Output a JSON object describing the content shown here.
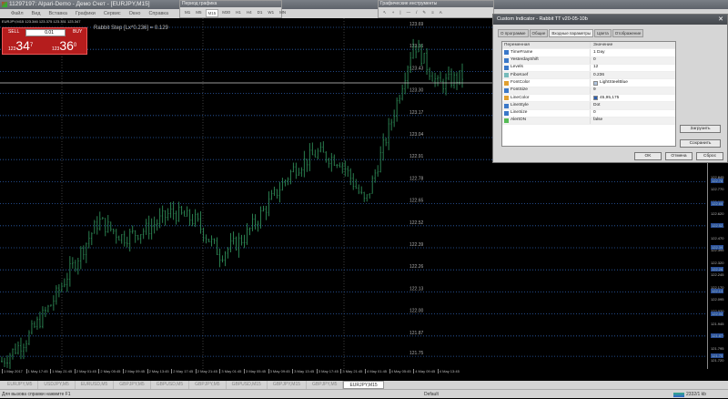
{
  "window": {
    "title": "11297197: Alpari-Demo - Демо Счет - [EURJPY,M15]"
  },
  "menu": [
    "Файл",
    "Вид",
    "Вставка",
    "Графики",
    "Сервис",
    "Окно",
    "Справка"
  ],
  "period_toolbar": {
    "title": "Период графика",
    "items": [
      "M1",
      "M5",
      "M15",
      "M30",
      "H1",
      "H4",
      "D1",
      "W1",
      "MN"
    ],
    "selected": "M15"
  },
  "tools_toolbar": {
    "title": "Графические инструменты",
    "items": [
      "↖",
      "+",
      "|",
      "—",
      "/",
      "✎",
      "≡",
      "A"
    ]
  },
  "chart": {
    "header": "EURJPY,M15  123.346 123.375 123.331 123.347",
    "sell_label": "SELL",
    "buy_label": "BUY",
    "lot": "0.01",
    "sell_price": {
      "big": "123",
      "main": "34",
      "pip": "7"
    },
    "buy_price": {
      "big": "123",
      "main": "36",
      "pip": "0"
    },
    "rabbit_text": "Rabbit Step [Lx*0.236] = 0.129",
    "levels": [
      "123.69",
      "123.56",
      "123.43",
      "123.30",
      "123.17",
      "123.04",
      "122.91",
      "122.78",
      "122.65",
      "122.52",
      "122.39",
      "122.26",
      "122.13",
      "122.00",
      "121.87",
      "121.75"
    ],
    "axis_labels": [
      "122.845",
      "122.770",
      "122.695",
      "122.620",
      "122.545",
      "122.470",
      "122.395",
      "122.320",
      "122.245",
      "122.170",
      "122.095",
      "122.020",
      "121.945",
      "121.870",
      "121.795",
      "121.720"
    ],
    "axis_highlight": [
      "122.78",
      "122.65",
      "122.52",
      "122.39",
      "122.26",
      "122.13",
      "122.00",
      "121.87",
      "121.75"
    ],
    "time_labels": [
      "1 May 2017",
      "1 May 17:45",
      "1 May 21:45",
      "2 May 01:45",
      "2 May 05:45",
      "2 May 09:45",
      "2 May 13:45",
      "2 May 17:45",
      "2 May 21:45",
      "3 May 01:45",
      "3 May 05:45",
      "3 May 09:45",
      "3 May 13:45",
      "3 May 17:45",
      "3 May 21:45",
      "4 May 01:45",
      "4 May 05:45",
      "4 May 09:45",
      "4 May 13:45"
    ],
    "candle_color": "#2e8b57"
  },
  "chart_data": {
    "type": "candlestick",
    "symbol": "EURJPY",
    "timeframe": "M15",
    "close_waypoints": [
      121.72,
      121.85,
      122.05,
      122.3,
      122.55,
      122.45,
      122.5,
      122.6,
      122.55,
      122.35,
      122.45,
      122.65,
      122.85,
      122.95,
      122.9,
      122.65,
      123.1,
      123.6,
      123.35,
      123.4
    ]
  },
  "tabs": [
    "EURJPY,M5",
    "USDJPY,M5",
    "EURUSD,M5",
    "GBPJPY,M5",
    "GBPUSD,M5",
    "GBPJPY,M5",
    "GBPUSD,M15",
    "GBPJPY,M15",
    "GBPJPY,M5",
    "EURJPY,M15"
  ],
  "active_tab": "EURJPY,M15",
  "status": {
    "help": "Для вызова справки нажмите F1",
    "profile": "Default",
    "traffic": "2332/1 kb"
  },
  "dialog": {
    "title": "Custom Indicator - Rabbit TT v20-05-10b",
    "tabs": [
      "О программе",
      "Общие",
      "Входные параметры",
      "Цвета",
      "Отображение"
    ],
    "col_name": "Переменная",
    "col_value": "Значение",
    "params": [
      {
        "name": "TimeFrame",
        "value": "1 Day",
        "t": "i"
      },
      {
        "name": "YesterdayShift",
        "value": "0",
        "t": "i"
      },
      {
        "name": "Levels",
        "value": "12",
        "t": "i"
      },
      {
        "name": "FiboKoef",
        "value": "0.236",
        "t": "f"
      },
      {
        "name": "FontColor",
        "value": "LightSteelBlue",
        "t": "c",
        "swatch": "#b0c4de"
      },
      {
        "name": "FontSize",
        "value": "9",
        "t": "i"
      },
      {
        "name": "LineColor",
        "value": "45,95,175",
        "t": "c",
        "swatch": "#2d5faf"
      },
      {
        "name": "LineStyle",
        "value": "Dot",
        "t": "i"
      },
      {
        "name": "LineSize",
        "value": "0",
        "t": "i"
      },
      {
        "name": "AlertON",
        "value": "false",
        "t": "b"
      }
    ],
    "load": "Загрузить",
    "save": "Сохранить",
    "ok": "OK",
    "cancel": "Отмена",
    "reset": "Сброс"
  }
}
